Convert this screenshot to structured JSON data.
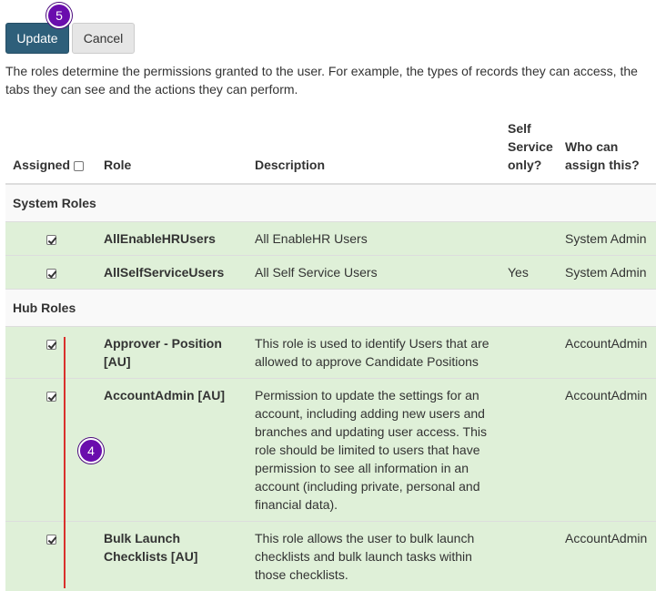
{
  "toolbar": {
    "update_label": "Update",
    "cancel_label": "Cancel"
  },
  "annotations": {
    "badge_update": "5",
    "badge_column": "4"
  },
  "intro_text": "The roles determine the permissions granted to the user. For example, the types of records they can access, the tabs they can see and the actions they can perform.",
  "table": {
    "headers": {
      "assigned": "Assigned",
      "role": "Role",
      "description": "Description",
      "self_service_line1": "Self",
      "self_service_line2": "Service",
      "self_service_line3": "only?",
      "who_line1": "Who can",
      "who_line2": "assign this?"
    },
    "groups": [
      {
        "name": "System Roles",
        "rows": [
          {
            "assigned": true,
            "role": "AllEnableHRUsers",
            "description": "All EnableHR Users",
            "self_service": "",
            "who": "System Admin"
          },
          {
            "assigned": true,
            "role": "AllSelfServiceUsers",
            "description": "All Self Service Users",
            "self_service": "Yes",
            "who": "System Admin"
          }
        ]
      },
      {
        "name": "Hub Roles",
        "rows": [
          {
            "assigned": true,
            "role": "Approver - Position [AU]",
            "description": "This role is used to identify Users that are allowed to approve Candidate Positions",
            "self_service": "",
            "who": "AccountAdmin"
          },
          {
            "assigned": true,
            "role": "AccountAdmin [AU]",
            "description": "Permission to update the settings for an account, including adding new users and branches and updating user access. This role should be limited to users that have permission to see all information in an account (including private, personal and financial data).",
            "self_service": "",
            "who": "AccountAdmin"
          },
          {
            "assigned": true,
            "role": "Bulk Launch Checklists [AU]",
            "description": "This role allows the user to bulk launch checklists and bulk launch tasks within those checklists.",
            "self_service": "",
            "who": "AccountAdmin"
          }
        ]
      }
    ]
  }
}
